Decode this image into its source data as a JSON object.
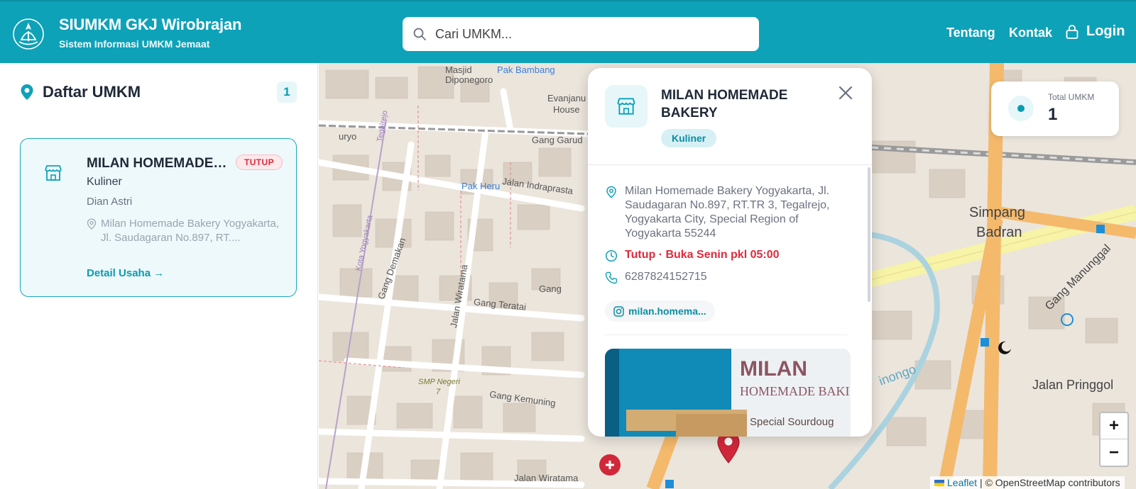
{
  "header": {
    "title": "SIUMKM GKJ Wirobrajan",
    "subtitle": "Sistem Informasi UMKM Jemaat",
    "search_placeholder": "Cari UMKM...",
    "nav": {
      "tentang": "Tentang",
      "kontak": "Kontak",
      "login": "Login"
    }
  },
  "sidebar": {
    "title": "Daftar UMKM",
    "count": "1",
    "items": [
      {
        "name": "MILAN HOMEMADE BAKERY",
        "status": "TUTUP",
        "category": "Kuliner",
        "owner": "Dian Astri",
        "address": "Milan Homemade Bakery Yogyakarta, Jl. Saudagaran No.897, RT....",
        "link": "Detail Usaha →"
      }
    ]
  },
  "popup": {
    "title": "MILAN HOMEMADE BAKERY",
    "category": "Kuliner",
    "address": "Milan Homemade Bakery Yogyakarta, Jl. Saudagaran No.897, RT.TR 3, Tegalrejo, Yogyakarta City, Special Region of Yogyakarta 55244",
    "status": "Tutup · Buka Senin pkl 05:00",
    "phone": "6287824152715",
    "instagram": "milan.homema...",
    "photo_text": {
      "line1": "MILAN",
      "line2": "HOMEMADE BAKI",
      "line3": "Special Sourdoug"
    }
  },
  "stats": {
    "label": "Total UMKM",
    "value": "1"
  },
  "map": {
    "labels": {
      "masjid": "Masjid",
      "diponegoro": "Diponegoro",
      "pak_bambang": "Pak Bambang",
      "evanjanu": "Evanjanu",
      "house": "House",
      "uryo": "uryo",
      "gang_garu": "Gang Garud",
      "tegalrejo": "Tegalrejo",
      "pak_heru": "Pak Heru",
      "jalan_indraprasta": "Jalan Indraprasta",
      "kota_yogyakarta": "Kota Yogyakarta",
      "gang_demakan": "Gang Demakan",
      "jalan_wiratama": "Jalan Wiratama",
      "gang": "Gang",
      "gang_teratai": "Gang Teratai",
      "smp_negeri": "SMP Negeri",
      "smp_7": "7",
      "gang_kemuning": "Gang Kemuning",
      "jalan_wirat": "Jalan Wiratama",
      "simpang": "Simpang",
      "badran": "Badran",
      "gang_manunggal": "Gang Manunggal",
      "jalan_pringgol": "Jalan Pringgol",
      "winongo": "inongo"
    },
    "zoom_in": "+",
    "zoom_out": "−",
    "attribution_leaflet": "Leaflet",
    "attribution_osm": "| © OpenStreetMap contributors"
  },
  "colors": {
    "primary": "#0ea2b8",
    "danger": "#e02a3c",
    "marker": "#d0283a"
  }
}
